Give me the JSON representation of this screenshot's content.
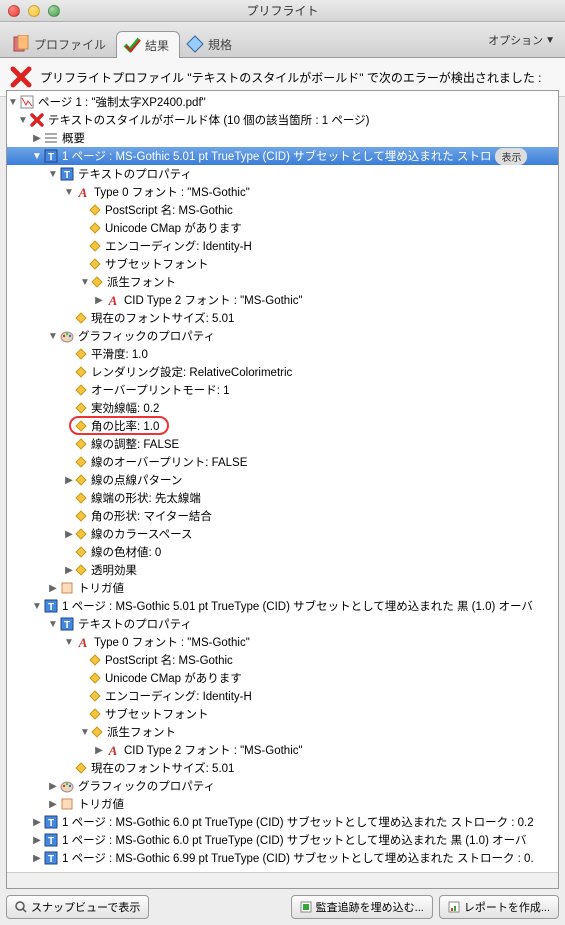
{
  "window": {
    "title": "プリフライト"
  },
  "tabs": [
    {
      "label": "プロファイル"
    },
    {
      "label": "結果"
    },
    {
      "label": "規格"
    }
  ],
  "options_label": "オプション",
  "error_message": "プリフライトプロファイル \"テキストのスタイルがボールド\" で次のエラーが検出されました :",
  "page_line": "ページ 1 : \"強制太字XP2400.pdf\"",
  "root_error": "テキストのスタイルがボールド体 (10 個の該当箇所 : 1 ページ)",
  "nodes": {
    "summary": "概要",
    "item1": "1 ページ : MS-Gothic 5.01 pt TrueType (CID) サブセットとして埋め込まれた ストロ",
    "show": "表示",
    "text_props": "テキストのプロパティ",
    "type0": "Type 0 フォント : \"MS-Gothic\"",
    "ps_name": "PostScript 名: MS-Gothic",
    "cmap": "Unicode CMap があります",
    "encoding": "エンコーディング: Identity-H",
    "subset": "サブセットフォント",
    "derived": "派生フォント",
    "cid2": "CID Type 2 フォント : \"MS-Gothic\"",
    "fontsize": "現在のフォントサイズ: 5.01",
    "gfx_props": "グラフィックのプロパティ",
    "smoothness": "平滑度: 1.0",
    "rendering": "レンダリング設定: RelativeColorimetric",
    "overprint_mode": "オーバープリントモード: 1",
    "line_width": "実効線幅: 0.2",
    "miter": "角の比率: 1.0",
    "stroke_adj": "線の調整: FALSE",
    "line_overprint": "線のオーバープリント: FALSE",
    "dash": "線の点線パターン",
    "cap": "線端の形状: 先太線端",
    "join": "角の形状: マイター結合",
    "colorspace": "線のカラースペース",
    "color_val": "線の色材値: 0",
    "transparency": "透明効果",
    "trigger": "トリガ値",
    "item2": "1 ページ : MS-Gothic 5.01 pt TrueType (CID) サブセットとして埋め込まれた 黒 (1.0) オーバ",
    "text_props2": "テキストのプロパティ",
    "type0_2": "Type 0 フォント : \"MS-Gothic\"",
    "ps_name2": "PostScript 名: MS-Gothic",
    "cmap2": "Unicode CMap があります",
    "encoding2": "エンコーディング: Identity-H",
    "subset2": "サブセットフォント",
    "derived2": "派生フォント",
    "cid2_2": "CID Type 2 フォント : \"MS-Gothic\"",
    "fontsize2": "現在のフォントサイズ: 5.01",
    "gfx_props2": "グラフィックのプロパティ",
    "trigger2": "トリガ値",
    "item3": "1 ページ : MS-Gothic 6.0 pt TrueType (CID) サブセットとして埋め込まれた ストローク : 0.2",
    "item4": "1 ページ : MS-Gothic 6.0 pt TrueType (CID) サブセットとして埋め込まれた 黒 (1.0) オーバ",
    "item5": "1 ページ : MS-Gothic 6.99 pt TrueType (CID) サブセットとして埋め込まれた ストローク : 0."
  },
  "footer": {
    "snap": "スナップビューで表示",
    "audit": "監査追跡を埋め込む...",
    "report": "レポートを作成..."
  }
}
